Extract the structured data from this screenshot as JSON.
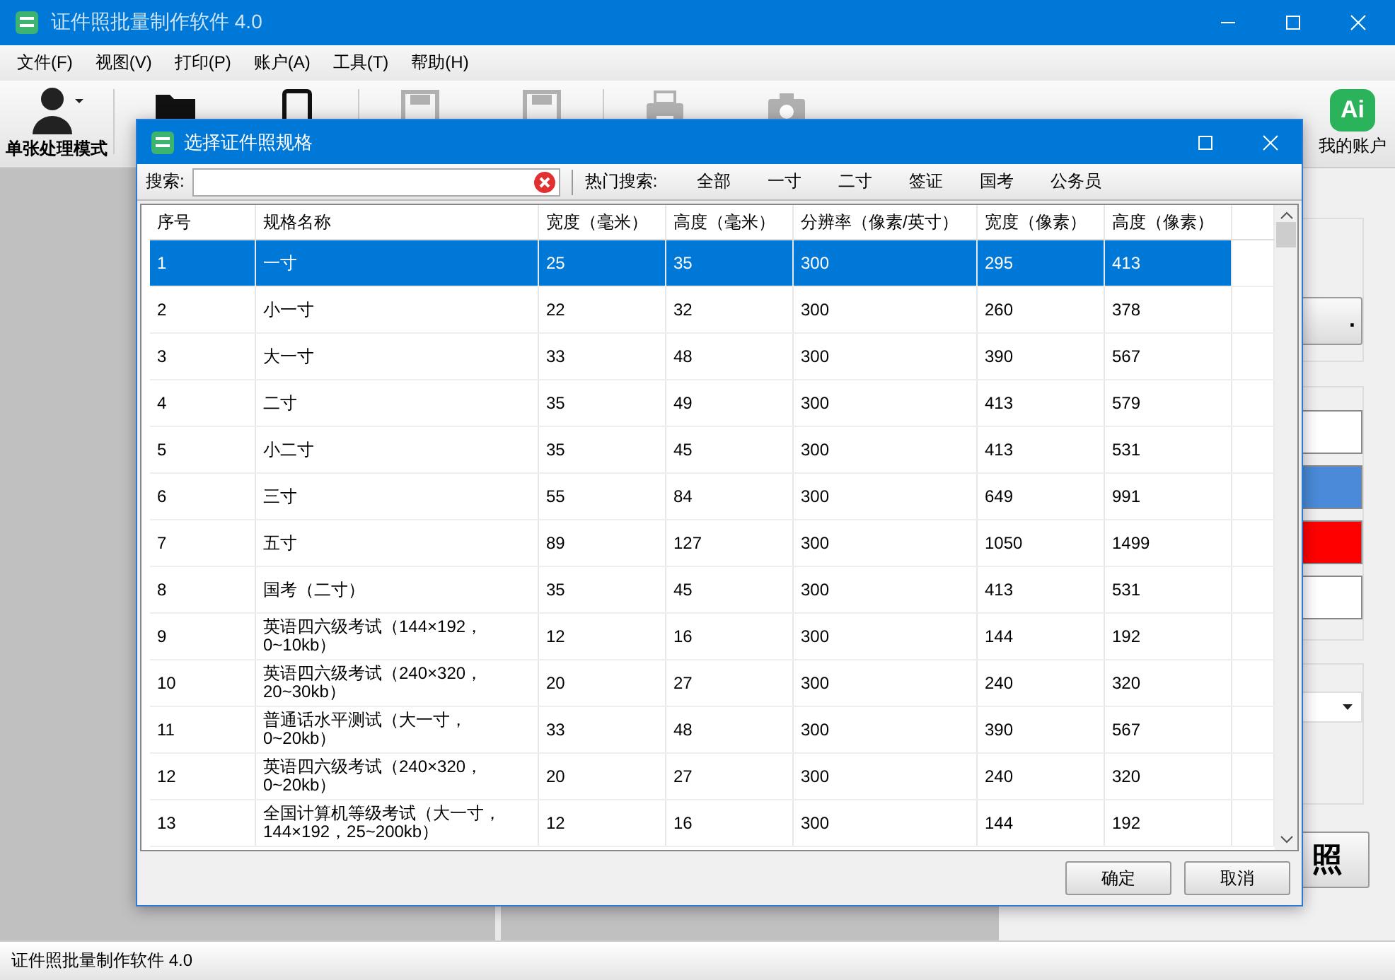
{
  "window": {
    "title": "证件照批量制作软件 4.0"
  },
  "menu": [
    "文件(F)",
    "视图(V)",
    "打印(P)",
    "账户(A)",
    "工具(T)",
    "帮助(H)"
  ],
  "toolbar": {
    "mode_button": "单张处理模式",
    "logo": "Ai",
    "account_button": "我的账户",
    "tools": [
      {
        "kind": "folder",
        "disabled": false
      },
      {
        "kind": "phone",
        "disabled": false
      },
      {
        "kind": "save",
        "disabled": true
      },
      {
        "kind": "save",
        "disabled": true
      },
      {
        "kind": "print",
        "disabled": true
      },
      {
        "kind": "camera",
        "disabled": true
      }
    ]
  },
  "side_panel": {
    "button_1": ".",
    "swatches": [
      {
        "color": "#ffffff"
      },
      {
        "color": "#4a8ad8"
      },
      {
        "color": "#ff0000"
      },
      {
        "color": "#ffffff"
      }
    ],
    "button_2": "照"
  },
  "dialog": {
    "title": "选择证件照规格",
    "search": {
      "label": "搜索:"
    },
    "hot_search": {
      "label": "热门搜索:",
      "items": [
        "全部",
        "一寸",
        "二寸",
        "签证",
        "国考",
        "公务员"
      ]
    },
    "table": {
      "columns": [
        "序号",
        "规格名称",
        "宽度（毫米）",
        "高度（毫米）",
        "分辨率（像素/英寸）",
        "宽度（像素）",
        "高度（像素）"
      ],
      "rows": [
        {
          "cells": [
            "1",
            "一寸",
            "25",
            "35",
            "300",
            "295",
            "413"
          ],
          "selected": true
        },
        {
          "cells": [
            "2",
            "小一寸",
            "22",
            "32",
            "300",
            "260",
            "378"
          ],
          "selected": false
        },
        {
          "cells": [
            "3",
            "大一寸",
            "33",
            "48",
            "300",
            "390",
            "567"
          ],
          "selected": false
        },
        {
          "cells": [
            "4",
            "二寸",
            "35",
            "49",
            "300",
            "413",
            "579"
          ],
          "selected": false
        },
        {
          "cells": [
            "5",
            "小二寸",
            "35",
            "45",
            "300",
            "413",
            "531"
          ],
          "selected": false
        },
        {
          "cells": [
            "6",
            "三寸",
            "55",
            "84",
            "300",
            "649",
            "991"
          ],
          "selected": false
        },
        {
          "cells": [
            "7",
            "五寸",
            "89",
            "127",
            "300",
            "1050",
            "1499"
          ],
          "selected": false
        },
        {
          "cells": [
            "8",
            "国考（二寸）",
            "35",
            "45",
            "300",
            "413",
            "531"
          ],
          "selected": false
        },
        {
          "cells": [
            "9",
            "英语四六级考试（144×192，0~10kb）",
            "12",
            "16",
            "300",
            "144",
            "192"
          ],
          "selected": false
        },
        {
          "cells": [
            "10",
            "英语四六级考试（240×320，20~30kb）",
            "20",
            "27",
            "300",
            "240",
            "320"
          ],
          "selected": false
        },
        {
          "cells": [
            "11",
            "普通话水平测试（大一寸，0~20kb）",
            "33",
            "48",
            "300",
            "390",
            "567"
          ],
          "selected": false
        },
        {
          "cells": [
            "12",
            "英语四六级考试（240×320，0~20kb）",
            "20",
            "27",
            "300",
            "240",
            "320"
          ],
          "selected": false
        },
        {
          "cells": [
            "13",
            "全国计算机等级考试（大一寸，144×192，25~200kb）",
            "12",
            "16",
            "300",
            "144",
            "192"
          ],
          "selected": false
        }
      ]
    },
    "buttons": [
      "确定",
      "取消"
    ]
  },
  "status_bar": "证件照批量制作软件 4.0"
}
